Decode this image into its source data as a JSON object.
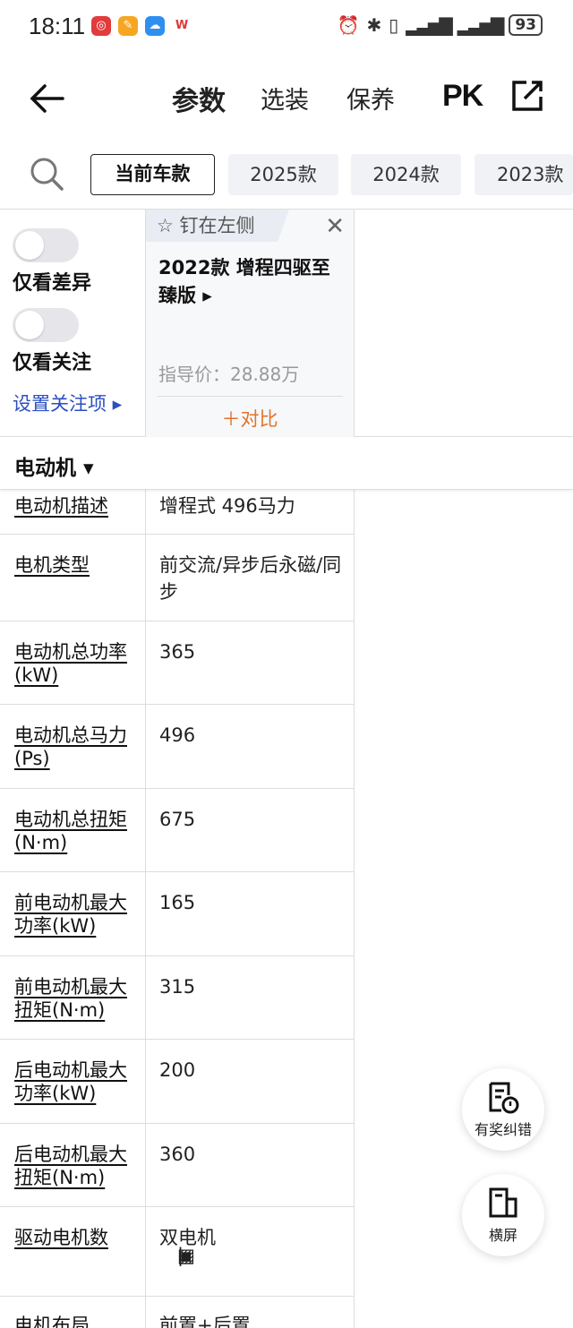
{
  "status_bar": {
    "time": "18:11",
    "battery": "93"
  },
  "nav": {
    "tabs": [
      "参数",
      "选装",
      "保养"
    ],
    "pk_label": "PK"
  },
  "year_filter": {
    "chips": [
      "当前车款",
      "2025款",
      "2024款",
      "2023款"
    ],
    "active_index": 0
  },
  "filters": {
    "only_diff": "仅看差异",
    "only_follow": "仅看关注",
    "set_follow": "设置关注项 ▸"
  },
  "car_card": {
    "pin_label": "钉在左侧",
    "name": "2022款 增程四驱至臻版 ▸",
    "price": "指导价：28.88万",
    "compare": "＋对比"
  },
  "section": {
    "title": "电动机 ▾"
  },
  "specs": [
    {
      "label": "电动机描述",
      "value": "增程式 496马力"
    },
    {
      "label": "电机类型",
      "value": "前交流/异步后永磁/同步"
    },
    {
      "label": "电动机总功率(kW)",
      "value": "365"
    },
    {
      "label": "电动机总马力(Ps)",
      "value": "496"
    },
    {
      "label": "电动机总扭矩(N·m)",
      "value": "675"
    },
    {
      "label": "前电动机最大功率(kW)",
      "value": "165"
    },
    {
      "label": "前电动机最大扭矩(N·m)",
      "value": "315"
    },
    {
      "label": "后电动机最大功率(kW)",
      "value": "200"
    },
    {
      "label": "后电动机最大扭矩(N·m)",
      "value": "360"
    },
    {
      "label": "驱动电机数",
      "value": "双电机"
    },
    {
      "label": "电机布局",
      "value": "前置+后置"
    }
  ],
  "floating": {
    "report": "有奖纠错",
    "landscape": "横屏"
  },
  "colors": {
    "accent_yellow": "#ffd54a",
    "link_blue": "#2b4fc3",
    "compare_orange": "#e2742a"
  }
}
